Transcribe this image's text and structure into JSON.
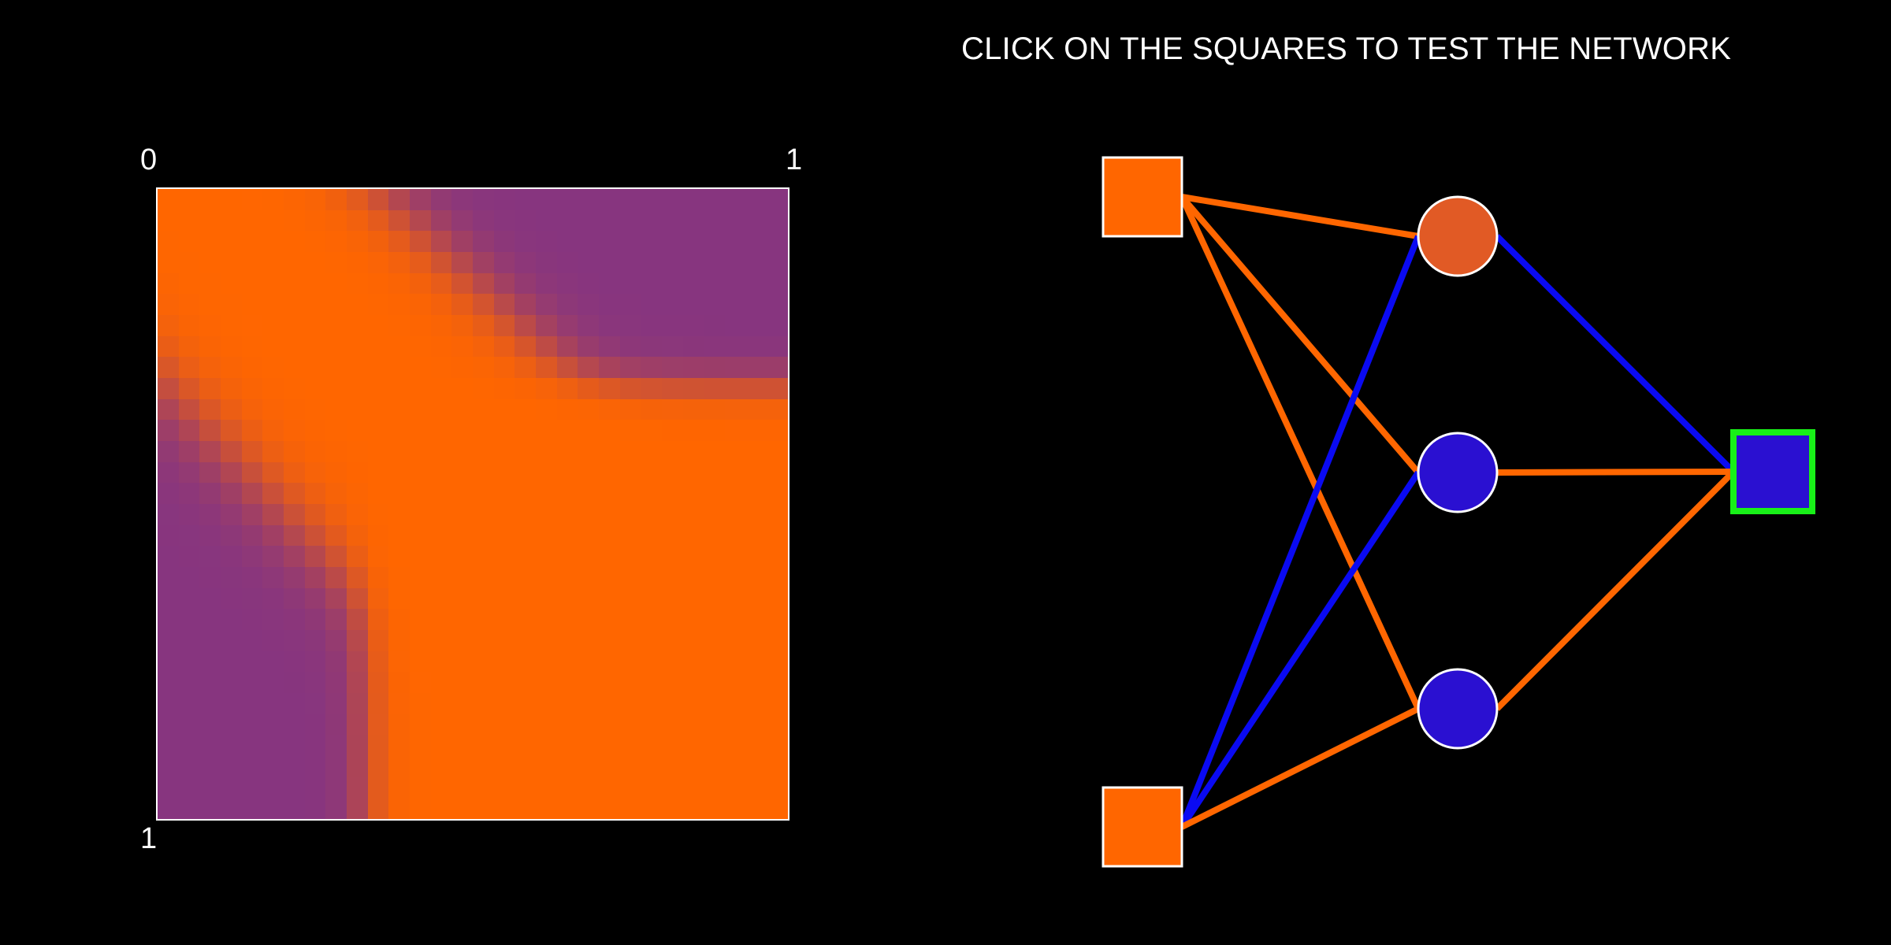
{
  "header": {
    "instruction": "CLICK ON THE SQUARES TO TEST THE NETWORK"
  },
  "output_map": {
    "labels": {
      "top_left": "0",
      "top_right": "1",
      "bottom_left": "1"
    },
    "grid_size": 30,
    "colors": {
      "orange": "#ff6600",
      "purple": "#87357f"
    }
  },
  "network": {
    "colors": {
      "orange": "#ff6600",
      "blue": "#0a0af2",
      "hidden_orange": "#e15a25",
      "hidden_blue": "#2a10d1",
      "output_blue": "#2a10d1",
      "node_border": "#ffffff",
      "output_border": "#18f018"
    },
    "inputs": [
      {
        "id": "input-top",
        "state": "orange"
      },
      {
        "id": "input-bottom",
        "state": "orange"
      }
    ],
    "hidden": [
      {
        "id": "hidden-1",
        "state": "orange"
      },
      {
        "id": "hidden-2",
        "state": "blue"
      },
      {
        "id": "hidden-3",
        "state": "blue"
      }
    ],
    "output": {
      "id": "output",
      "state": "blue",
      "selected": true
    },
    "connections": [
      {
        "from": "input-top",
        "to": "hidden-1",
        "color": "orange"
      },
      {
        "from": "input-top",
        "to": "hidden-2",
        "color": "orange"
      },
      {
        "from": "input-top",
        "to": "hidden-3",
        "color": "orange"
      },
      {
        "from": "input-bottom",
        "to": "hidden-1",
        "color": "blue"
      },
      {
        "from": "input-bottom",
        "to": "hidden-2",
        "color": "blue"
      },
      {
        "from": "input-bottom",
        "to": "hidden-3",
        "color": "orange"
      },
      {
        "from": "hidden-1",
        "to": "output",
        "color": "blue"
      },
      {
        "from": "hidden-2",
        "to": "output",
        "color": "orange"
      },
      {
        "from": "hidden-3",
        "to": "output",
        "color": "orange"
      }
    ]
  }
}
